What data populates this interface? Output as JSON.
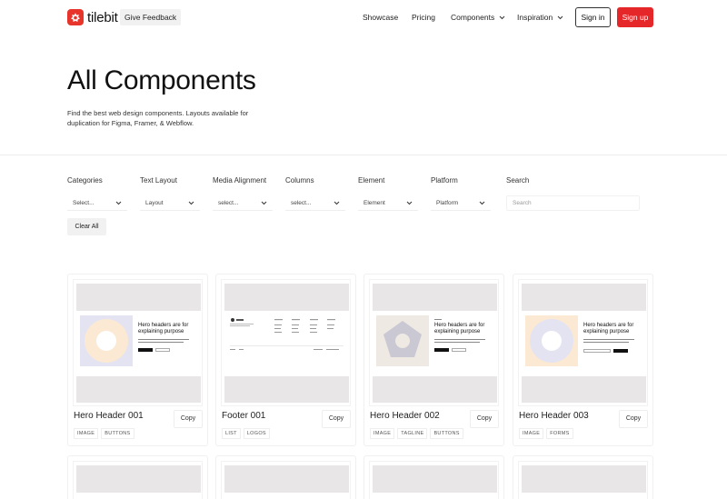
{
  "nav": {
    "brand": "tilebit",
    "feedback": "Give Feedback",
    "links": [
      "Showcase",
      "Pricing",
      "Components",
      "Inspiration"
    ],
    "signin": "Sign in",
    "signup": "Sign up"
  },
  "hero": {
    "title": "All Components",
    "description": "Find the best web design components. Layouts available for duplication for Figma, Framer, & Webflow."
  },
  "filters": [
    {
      "label": "Categories",
      "value": "Select..."
    },
    {
      "label": "Text Layout",
      "value": "Layout"
    },
    {
      "label": "Media Alignment",
      "value": "select..."
    },
    {
      "label": "Columns",
      "value": "select..."
    },
    {
      "label": "Element",
      "value": "Element"
    },
    {
      "label": "Platform",
      "value": "Platform"
    }
  ],
  "search": {
    "label": "Search",
    "placeholder": "Search"
  },
  "clear": "Clear All",
  "copy_label": "Copy",
  "thumb_text": {
    "hero_heading": "Hero headers are for explaining purpose"
  },
  "cards": [
    {
      "title": "Hero Header 001",
      "tags": [
        "IMAGE",
        "BUTTONS"
      ]
    },
    {
      "title": "Footer 001",
      "tags": [
        "LIST",
        "LOGOS"
      ]
    },
    {
      "title": "Hero Header 002",
      "tags": [
        "IMAGE",
        "TAGLINE",
        "BUTTONS"
      ]
    },
    {
      "title": "Hero Header 003",
      "tags": [
        "IMAGE",
        "FORMS"
      ]
    }
  ],
  "colors": {
    "brand": "#e8352b",
    "signup": "#e5272a",
    "thumb_gray": "#e8e6e7",
    "ring_lavender": "#e4e3f1",
    "ring_peach": "#fbe9d4",
    "pentagon": "#c9c8d3"
  }
}
